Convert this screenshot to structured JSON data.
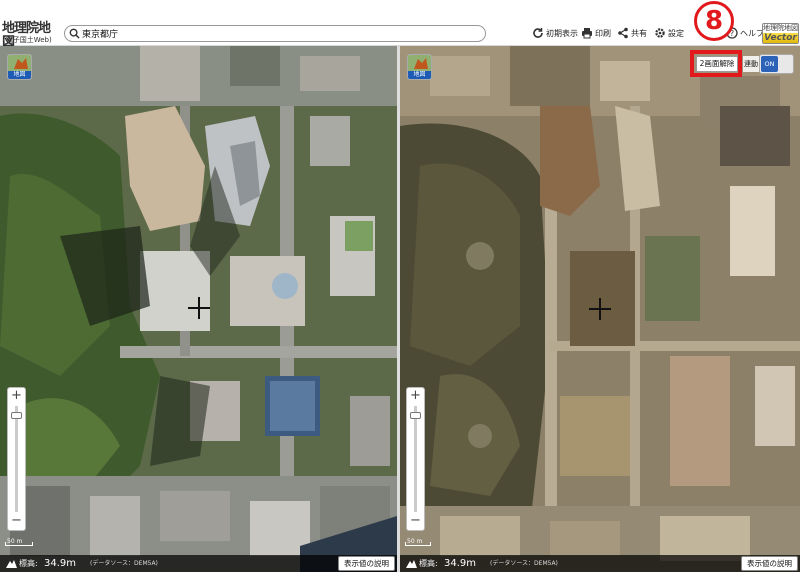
{
  "header": {
    "logo_title": "地理院地図",
    "logo_subtitle": "(電子国土Web)",
    "search_value": "東京都庁",
    "buttons": {
      "reset_view": "初期表示",
      "print": "印刷",
      "share": "共有",
      "settings": "設定",
      "help": "ヘルプ"
    },
    "brand_top": "地理院地図",
    "brand_bottom": "Vector"
  },
  "left_map": {
    "layer_button_label": "地図",
    "scale_label": "50 m",
    "elevation_label": "標高:",
    "elevation_value": "34.9m",
    "data_source": "(データソース：DEM5A)",
    "explain_button": "表示値の説明"
  },
  "right_map": {
    "layer_button_label": "地図",
    "split_off_button": "2画面解除",
    "sync_label": "連動",
    "sync_toggle": "ON",
    "scale_label": "50 m",
    "elevation_label": "標高:",
    "elevation_value": "34.9m",
    "data_source": "(データソース：DEM5A)",
    "explain_button": "表示値の説明"
  },
  "annotation": {
    "step_number": "8",
    "color": "#e1191d"
  },
  "icons": [
    "search-icon",
    "reload-icon",
    "print-icon",
    "share-icon",
    "gear-icon",
    "help-icon",
    "layers-icon",
    "crosshair-icon",
    "zoom-in-icon",
    "zoom-out-icon",
    "elevation-icon"
  ]
}
